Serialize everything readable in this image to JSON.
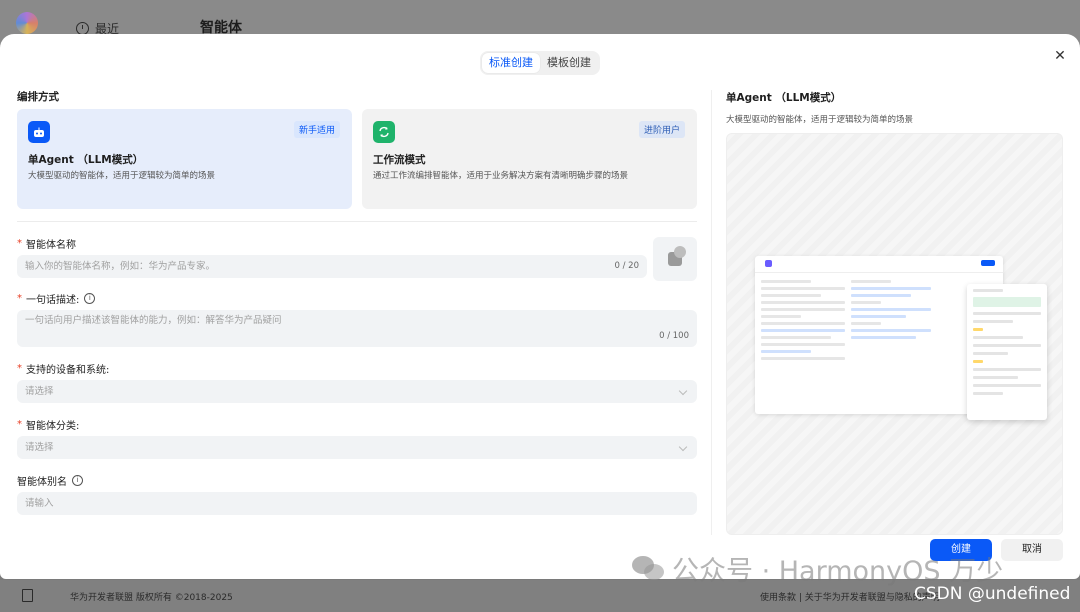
{
  "background": {
    "recent_label": "最近",
    "page_title": "智能体",
    "footer_copyright": "华为开发者联盟 版权所有 ©2018-2025",
    "footer_links": "使用条款 | 关于华为开发者联盟与隐私的声明"
  },
  "modal": {
    "tabs": [
      {
        "label": "标准创建",
        "active": true
      },
      {
        "label": "模板创建",
        "active": false
      }
    ],
    "section_title": "编排方式",
    "cards": [
      {
        "icon": "robot-icon",
        "tag": "新手适用",
        "title": "单Agent （LLM模式）",
        "desc": "大模型驱动的智能体，适用于逻辑较为简单的场景",
        "selected": true,
        "color": "#0a59f7"
      },
      {
        "icon": "workflow-icon",
        "tag": "进阶用户",
        "title": "工作流模式",
        "desc": "通过工作流编排智能体，适用于业务解决方案有清晰明确步骤的场景",
        "selected": false,
        "color": "#1fb36b"
      }
    ],
    "fields": {
      "name": {
        "label": "智能体名称",
        "placeholder": "输入你的智能体名称，例如：华为产品专家。",
        "count": "0 / 20"
      },
      "desc": {
        "label": "一句话描述:",
        "placeholder": "一句话向用户描述该智能体的能力，例如：解答华为产品疑问",
        "count": "0 / 100"
      },
      "devices": {
        "label": "支持的设备和系统:",
        "placeholder": "请选择"
      },
      "category": {
        "label": "智能体分类:",
        "placeholder": "请选择"
      },
      "alias": {
        "label": "智能体别名",
        "placeholder": "请输入"
      }
    },
    "preview": {
      "title": "单Agent （LLM模式）",
      "desc": "大模型驱动的智能体，适用于逻辑较为简单的场景"
    },
    "buttons": {
      "create": "创建",
      "cancel": "取消"
    }
  },
  "watermark": {
    "text": "公众号 · HarmonyOS 万少",
    "csdn": "CSDN @undefined"
  },
  "colors": {
    "accent": "#0a59f7",
    "required": "#e84026"
  }
}
